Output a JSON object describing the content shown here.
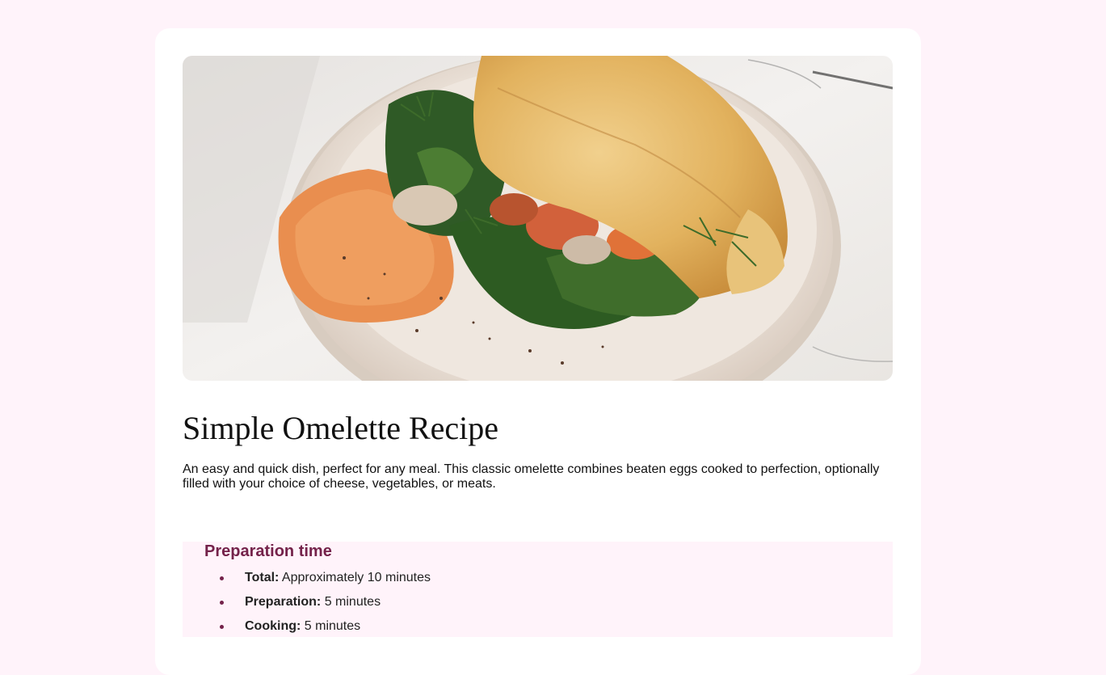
{
  "recipe": {
    "title": "Simple Omelette Recipe",
    "description": "An easy and quick dish, perfect for any meal. This classic omelette combines beaten eggs cooked to perfection, optionally filled with your choice of cheese, vegetables, or meats.",
    "hero_image": "omelette-plate-photo"
  },
  "preparation": {
    "heading": "Preparation time",
    "items": [
      {
        "label": "Total:",
        "value": " Approximately 10 minutes"
      },
      {
        "label": "Preparation:",
        "value": " 5 minutes"
      },
      {
        "label": "Cooking:",
        "value": " 5 minutes"
      }
    ]
  },
  "colors": {
    "page_background": "#fff3fa",
    "card_background": "#ffffff",
    "accent": "#74224a"
  }
}
